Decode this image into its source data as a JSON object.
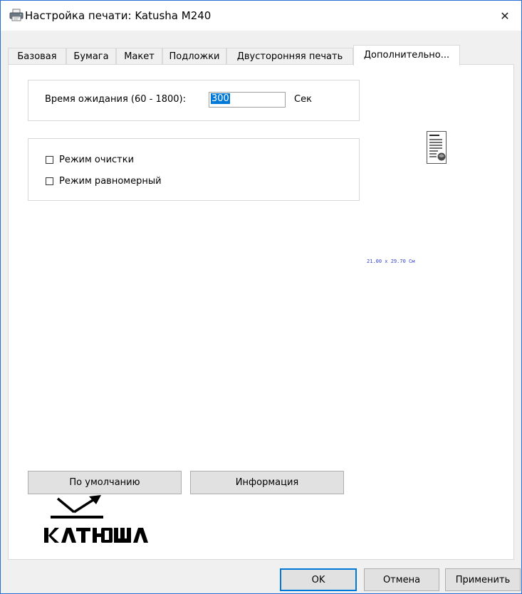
{
  "window": {
    "title": "Настройка печати: Katusha M240",
    "close_glyph": "✕"
  },
  "tabs": [
    {
      "label": "Базовая"
    },
    {
      "label": "Бумага"
    },
    {
      "label": "Макет"
    },
    {
      "label": "Подложки"
    },
    {
      "label": "Двусторонняя печать"
    },
    {
      "label": "Дополнительно...",
      "active": true
    }
  ],
  "timeout": {
    "label": "Время ожидания (60 - 1800):",
    "value": "300",
    "unit": "Сек"
  },
  "modes": {
    "cleaning": {
      "label": "Режим очистки",
      "checked": false
    },
    "uniform": {
      "label": "Режим равномерный",
      "checked": false
    }
  },
  "preview": {
    "icon": "document-preview-icon",
    "paper_size": "21.00 x 29.70 См"
  },
  "panel_buttons": {
    "defaults": "По умолчанию",
    "info": "Информация"
  },
  "logo": {
    "name": "katusha-logo",
    "text": "катюша"
  },
  "footer": {
    "ok": "OK",
    "cancel": "Отмена",
    "apply": "Применить"
  },
  "colors": {
    "accent": "#0078d7",
    "frame": "#2a6fd6",
    "paper_size_text": "#3344cc"
  }
}
